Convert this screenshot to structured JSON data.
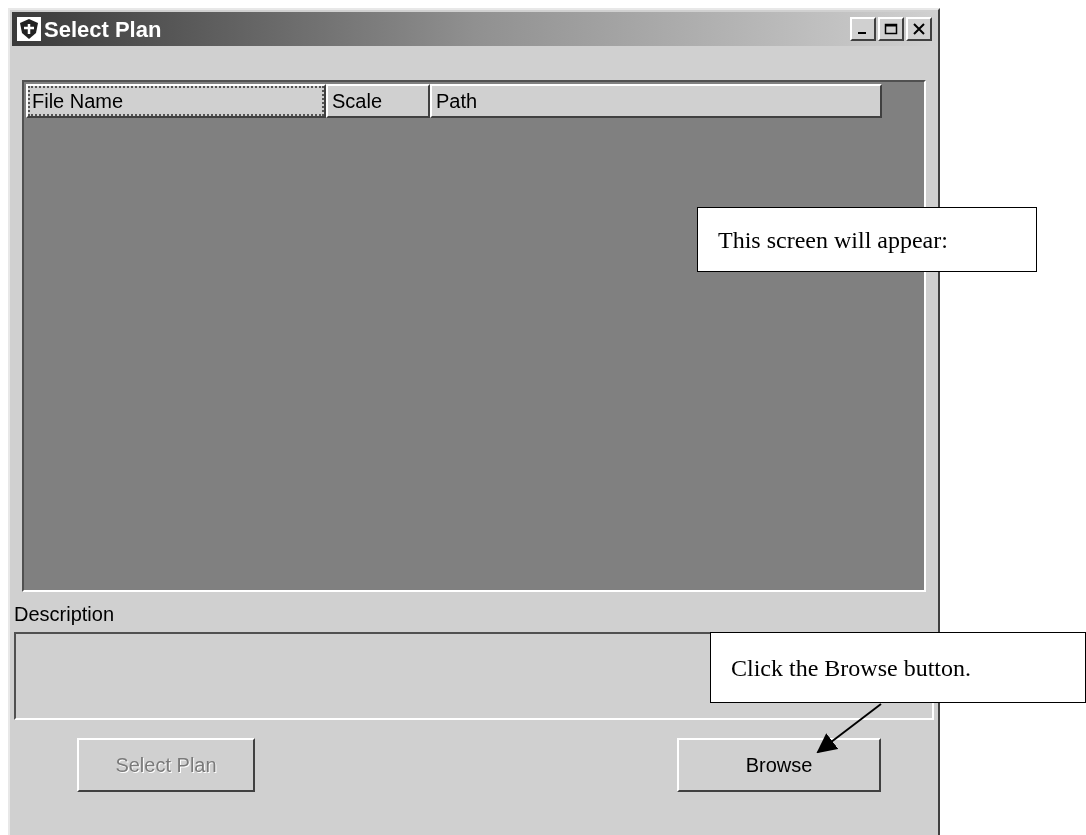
{
  "window": {
    "title": "Select Plan"
  },
  "table": {
    "columns": [
      {
        "label": "File Name",
        "focused": true
      },
      {
        "label": "Scale",
        "focused": false
      },
      {
        "label": "Path",
        "focused": false
      }
    ]
  },
  "description": {
    "label": "Description"
  },
  "buttons": [
    {
      "label": "Select Plan",
      "disabled": true
    },
    {
      "label": "Browse",
      "disabled": false
    }
  ],
  "callouts": [
    {
      "text": "This screen will appear:"
    },
    {
      "text": "Click the Browse button.",
      "arrow": true
    }
  ]
}
